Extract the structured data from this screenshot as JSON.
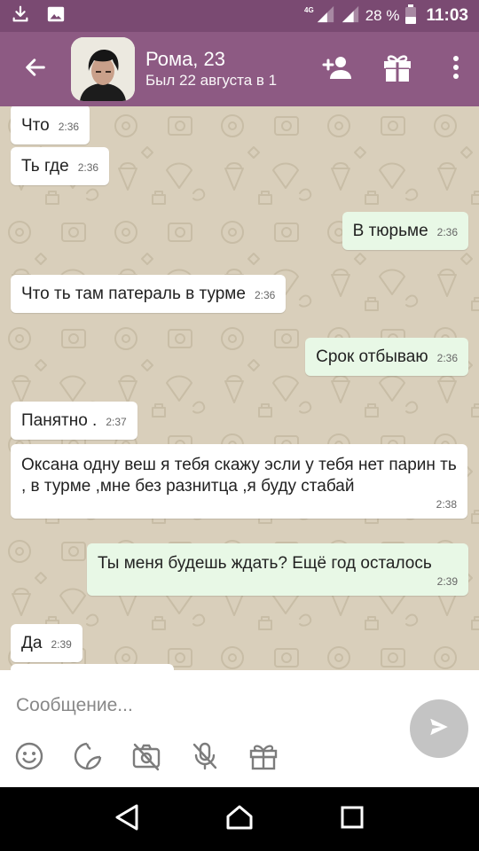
{
  "status_bar": {
    "network_type": "4G",
    "battery": "28 %",
    "time": "11:03",
    "icons": [
      "download-icon",
      "image-icon",
      "signal-icon",
      "battery-icon"
    ]
  },
  "header": {
    "contact_name": "Рома, 23",
    "last_seen": "Был 22 августа в 1",
    "icons": [
      "back-arrow-icon",
      "add-friend-icon",
      "gift-icon",
      "more-vert-icon"
    ],
    "color": "#8d5a83",
    "status_color": "#7a4a72"
  },
  "messages": [
    {
      "text": "Что",
      "time": "2:36",
      "direction": "in"
    },
    {
      "text": "Ть где",
      "time": "2:36",
      "direction": "in"
    },
    {
      "text": "В тюрьме",
      "time": "2:36",
      "direction": "out"
    },
    {
      "text": "Что ть там патераль в турме",
      "time": "2:36",
      "direction": "in"
    },
    {
      "text": "Срок отбываю",
      "time": "2:36",
      "direction": "out"
    },
    {
      "text": "Панятно .",
      "time": "2:37",
      "direction": "in"
    },
    {
      "text": "Оксана одну веш я тебя скажу эсли у тебя нет парин ть , в турме ,мне без разнитца ,я буду стабай",
      "time": "2:38",
      "direction": "in"
    },
    {
      "text": "Ты меня будешь ждать? Ещё год осталось",
      "time": "2:39",
      "direction": "out"
    },
    {
      "text": "Да",
      "time": "2:39",
      "direction": "in"
    }
  ],
  "composer": {
    "placeholder": "Сообщение...",
    "value": "",
    "tools": [
      "emoji-icon",
      "sticker-icon",
      "camera-off-icon",
      "mic-off-icon",
      "gift-icon"
    ],
    "send_icon": "send-icon"
  },
  "colors": {
    "incoming_bubble": "#ffffff",
    "outgoing_bubble": "#e8f8e6",
    "chat_background": "#d9cfbb",
    "send_button": "#c4c4c4"
  }
}
